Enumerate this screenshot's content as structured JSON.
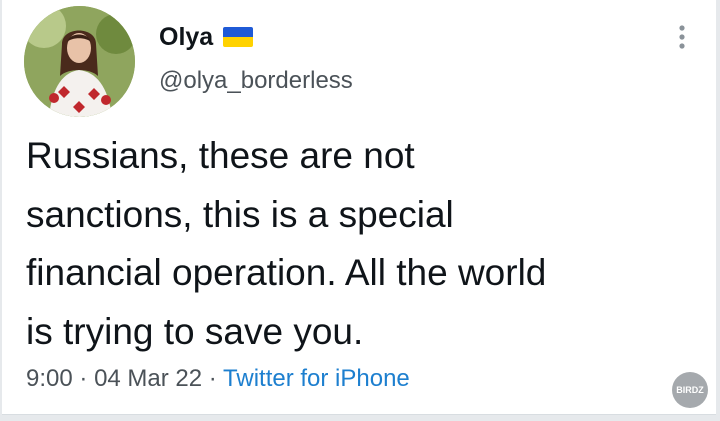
{
  "tweet": {
    "author": {
      "display_name": "Olya",
      "handle": "@olya_borderless",
      "flag_icon": "ukraine-flag-icon"
    },
    "text_lines": [
      "Russians, these are not",
      "sanctions, this is a special",
      "financial operation. All the world",
      "is trying to save you."
    ],
    "time": "9:00",
    "separator": "·",
    "date": "04 Mar 22",
    "source": "Twitter for iPhone",
    "more_icon": "more-options-icon"
  },
  "watermark": {
    "text": "BIRDZ"
  },
  "colors": {
    "text": "#0f1419",
    "secondary": "#4b5258",
    "link": "#1d7fcf",
    "flag_blue": "#1f5ad6",
    "flag_yellow": "#ffd200"
  }
}
